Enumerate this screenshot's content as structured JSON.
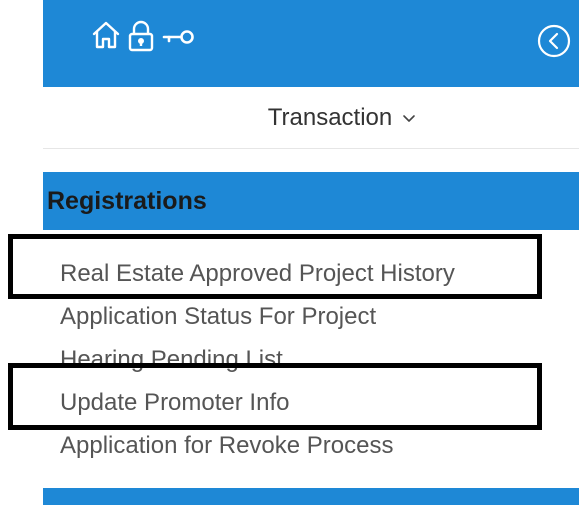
{
  "header": {
    "icons": [
      "home-icon",
      "lock-icon",
      "key-icon",
      "collapse-icon"
    ]
  },
  "transaction": {
    "label": "Transaction"
  },
  "section": {
    "title": "Registrations"
  },
  "menu": {
    "items": [
      {
        "label": "Real Estate Approved Project History"
      },
      {
        "label": "Application Status For Project"
      },
      {
        "label": "Hearing Pending List"
      },
      {
        "label": "Update Promoter Info"
      },
      {
        "label": "Application for Revoke Process"
      }
    ]
  },
  "colors": {
    "accent": "#1e88d6",
    "text": "#555555",
    "highlight": "#000000"
  }
}
